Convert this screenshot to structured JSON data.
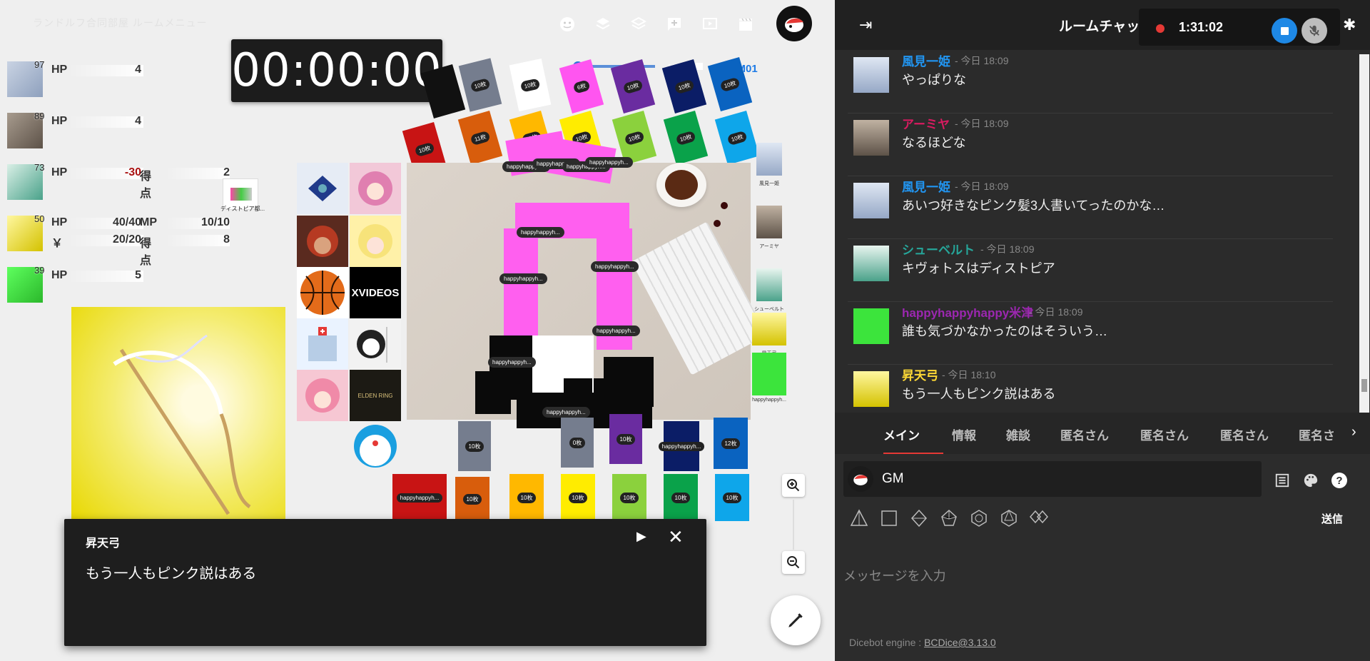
{
  "room_title": "ランドルフ合同部屋 ルームメニュー",
  "timer": "00:00:00",
  "bgm_label": "BGM01",
  "statuses": [
    {
      "num": "97",
      "rows": [
        {
          "label": "HP",
          "value": "4"
        }
      ]
    },
    {
      "num": "89",
      "rows": [
        {
          "label": "HP",
          "value": "4"
        }
      ]
    },
    {
      "num": "73",
      "rows": [
        {
          "label": "HP",
          "value": "-30",
          "label2": "得点",
          "value2": "2"
        }
      ]
    },
    {
      "num": "50",
      "rows": [
        {
          "label": "HP",
          "value": "40/40",
          "label2": "MP",
          "value2": "10/10"
        },
        {
          "label": "￥",
          "value": "20/20",
          "label2": "得点",
          "value2": "8"
        }
      ]
    },
    {
      "num": "39",
      "rows": [
        {
          "label": "HP",
          "value": "5"
        }
      ]
    }
  ],
  "dystopia_card": "ディストピア都...",
  "xvideos_logo": "XVIDEOS",
  "elden_ring": "ELDEN RING",
  "card_counts": [
    "10枚",
    "10枚",
    "6枚",
    "10枚",
    "10枚",
    "10枚",
    "10枚",
    "11枚",
    "10枚",
    "10枚",
    "10枚",
    "10枚",
    "10枚",
    "10枚",
    "10枚",
    "12枚",
    "10枚",
    "10枚",
    "10枚",
    "10枚",
    "10枚",
    "10枚",
    "10枚",
    "10枚",
    "10枚",
    "10枚",
    "0枚"
  ],
  "card_tag": "happyhappyh...",
  "pieces": [
    "風見一姫",
    "アーミヤ",
    "シューベルト",
    "昇天弓",
    "happyhappyh..."
  ],
  "popup": {
    "name": "昇天弓",
    "text": "もう一人もピンク説はある"
  },
  "chat": {
    "title": "ルームチャット",
    "rec_time": "1:31:02",
    "messages": [
      {
        "name": "風見一姫",
        "time": "- 今日 18:09",
        "text": "やっぱりな",
        "color": "#2196f3"
      },
      {
        "name": "アーミヤ",
        "time": "- 今日 18:09",
        "text": "なるほどな",
        "color": "#d81b60"
      },
      {
        "name": "風見一姫",
        "time": "- 今日 18:09",
        "text": "あいつ好きなピンク髪3人書いてったのかな…",
        "color": "#2196f3"
      },
      {
        "name": "シューベルト",
        "time": "- 今日 18:09",
        "text": "キヴォトスはディストピア",
        "color": "#26a69a"
      },
      {
        "name": "happyhappyhappy米津",
        "time": "- 今日 18:09",
        "text": "誰も気づかなかったのはそういう…",
        "color": "#9c27b0"
      },
      {
        "name": "昇天弓",
        "time": "- 今日 18:10",
        "text": "もう一人もピンク説はある",
        "color": "#fdd835"
      }
    ],
    "tabs": [
      "メイン",
      "情報",
      "雑談",
      "匿名さん",
      "匿名さん",
      "匿名さん",
      "匿名さ"
    ],
    "character": "GM",
    "send": "送信",
    "placeholder": "メッセージを入力",
    "footer_label": "Dicebot engine : ",
    "footer_link": "BCDice@3.13.0"
  }
}
